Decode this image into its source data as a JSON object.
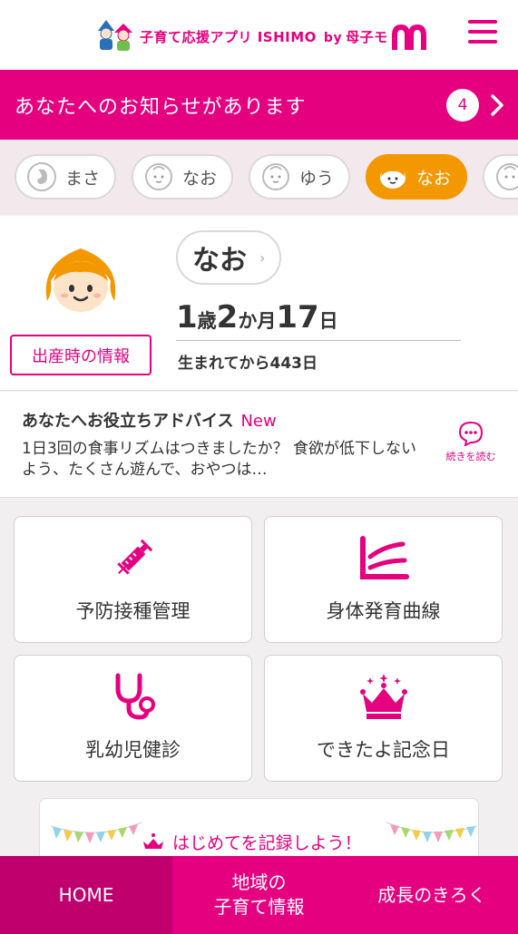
{
  "header": {
    "app_title": "子育て応援アプリ ISHIMO",
    "by": "by",
    "brand": "母子モ",
    "icons": {
      "logo": "kids-logo-icon",
      "brand": "penguin-logo-icon",
      "menu": "hamburger-menu-icon"
    }
  },
  "notice": {
    "text": "あなたへのお知らせがあります",
    "count": "4"
  },
  "children": [
    {
      "name": "まさ",
      "icon": "fetus-icon",
      "active": false
    },
    {
      "name": "なお",
      "icon": "baby-face-icon",
      "active": false
    },
    {
      "name": "ゆう",
      "icon": "baby-face-icon",
      "active": false
    },
    {
      "name": "なお",
      "icon": "child-face-icon",
      "active": true
    }
  ],
  "profile": {
    "name": "なお",
    "birth_info_button": "出産時の情報",
    "age": {
      "years": "1",
      "years_unit": "歳",
      "months": "2",
      "months_unit": "か月",
      "days": "17",
      "days_unit": "日"
    },
    "since_birth": "生まれてから443日"
  },
  "advice": {
    "title": "あなたへお役立ちアドバイス",
    "badge": "New",
    "body": "1日3回の食事リズムはつきましたか？ 食欲が低下しないよう、たくさん遊んで、おやつは…",
    "read_more": "続きを読む"
  },
  "menu": [
    {
      "label": "予防接種管理",
      "icon": "syringe-icon"
    },
    {
      "label": "身体発育曲線",
      "icon": "growth-curve-icon"
    },
    {
      "label": "乳幼児健診",
      "icon": "stethoscope-icon"
    },
    {
      "label": "できたよ記念日",
      "icon": "crown-icon"
    }
  ],
  "first_record": {
    "text": "はじめてを記録しよう！"
  },
  "bottom_nav": {
    "home": "HOME",
    "local_line1": "地域の",
    "local_line2": "子育て情報",
    "growth": "成長のきろく"
  },
  "colors": {
    "accent": "#e5007f",
    "active_tab": "#f39800",
    "background": "#f2eff0"
  }
}
